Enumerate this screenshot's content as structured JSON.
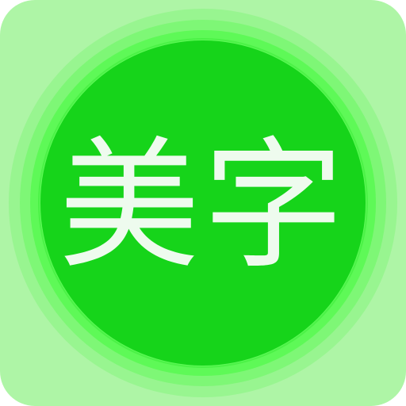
{
  "app_icon": {
    "logo_text": "美字",
    "colors": {
      "background": "#aef5a6",
      "outer_ring": "#98f590",
      "middle_ring": "#7ef776",
      "inner_ring": "#5ef957",
      "center_disc": "#16d41a",
      "text": "#eefbee"
    }
  }
}
